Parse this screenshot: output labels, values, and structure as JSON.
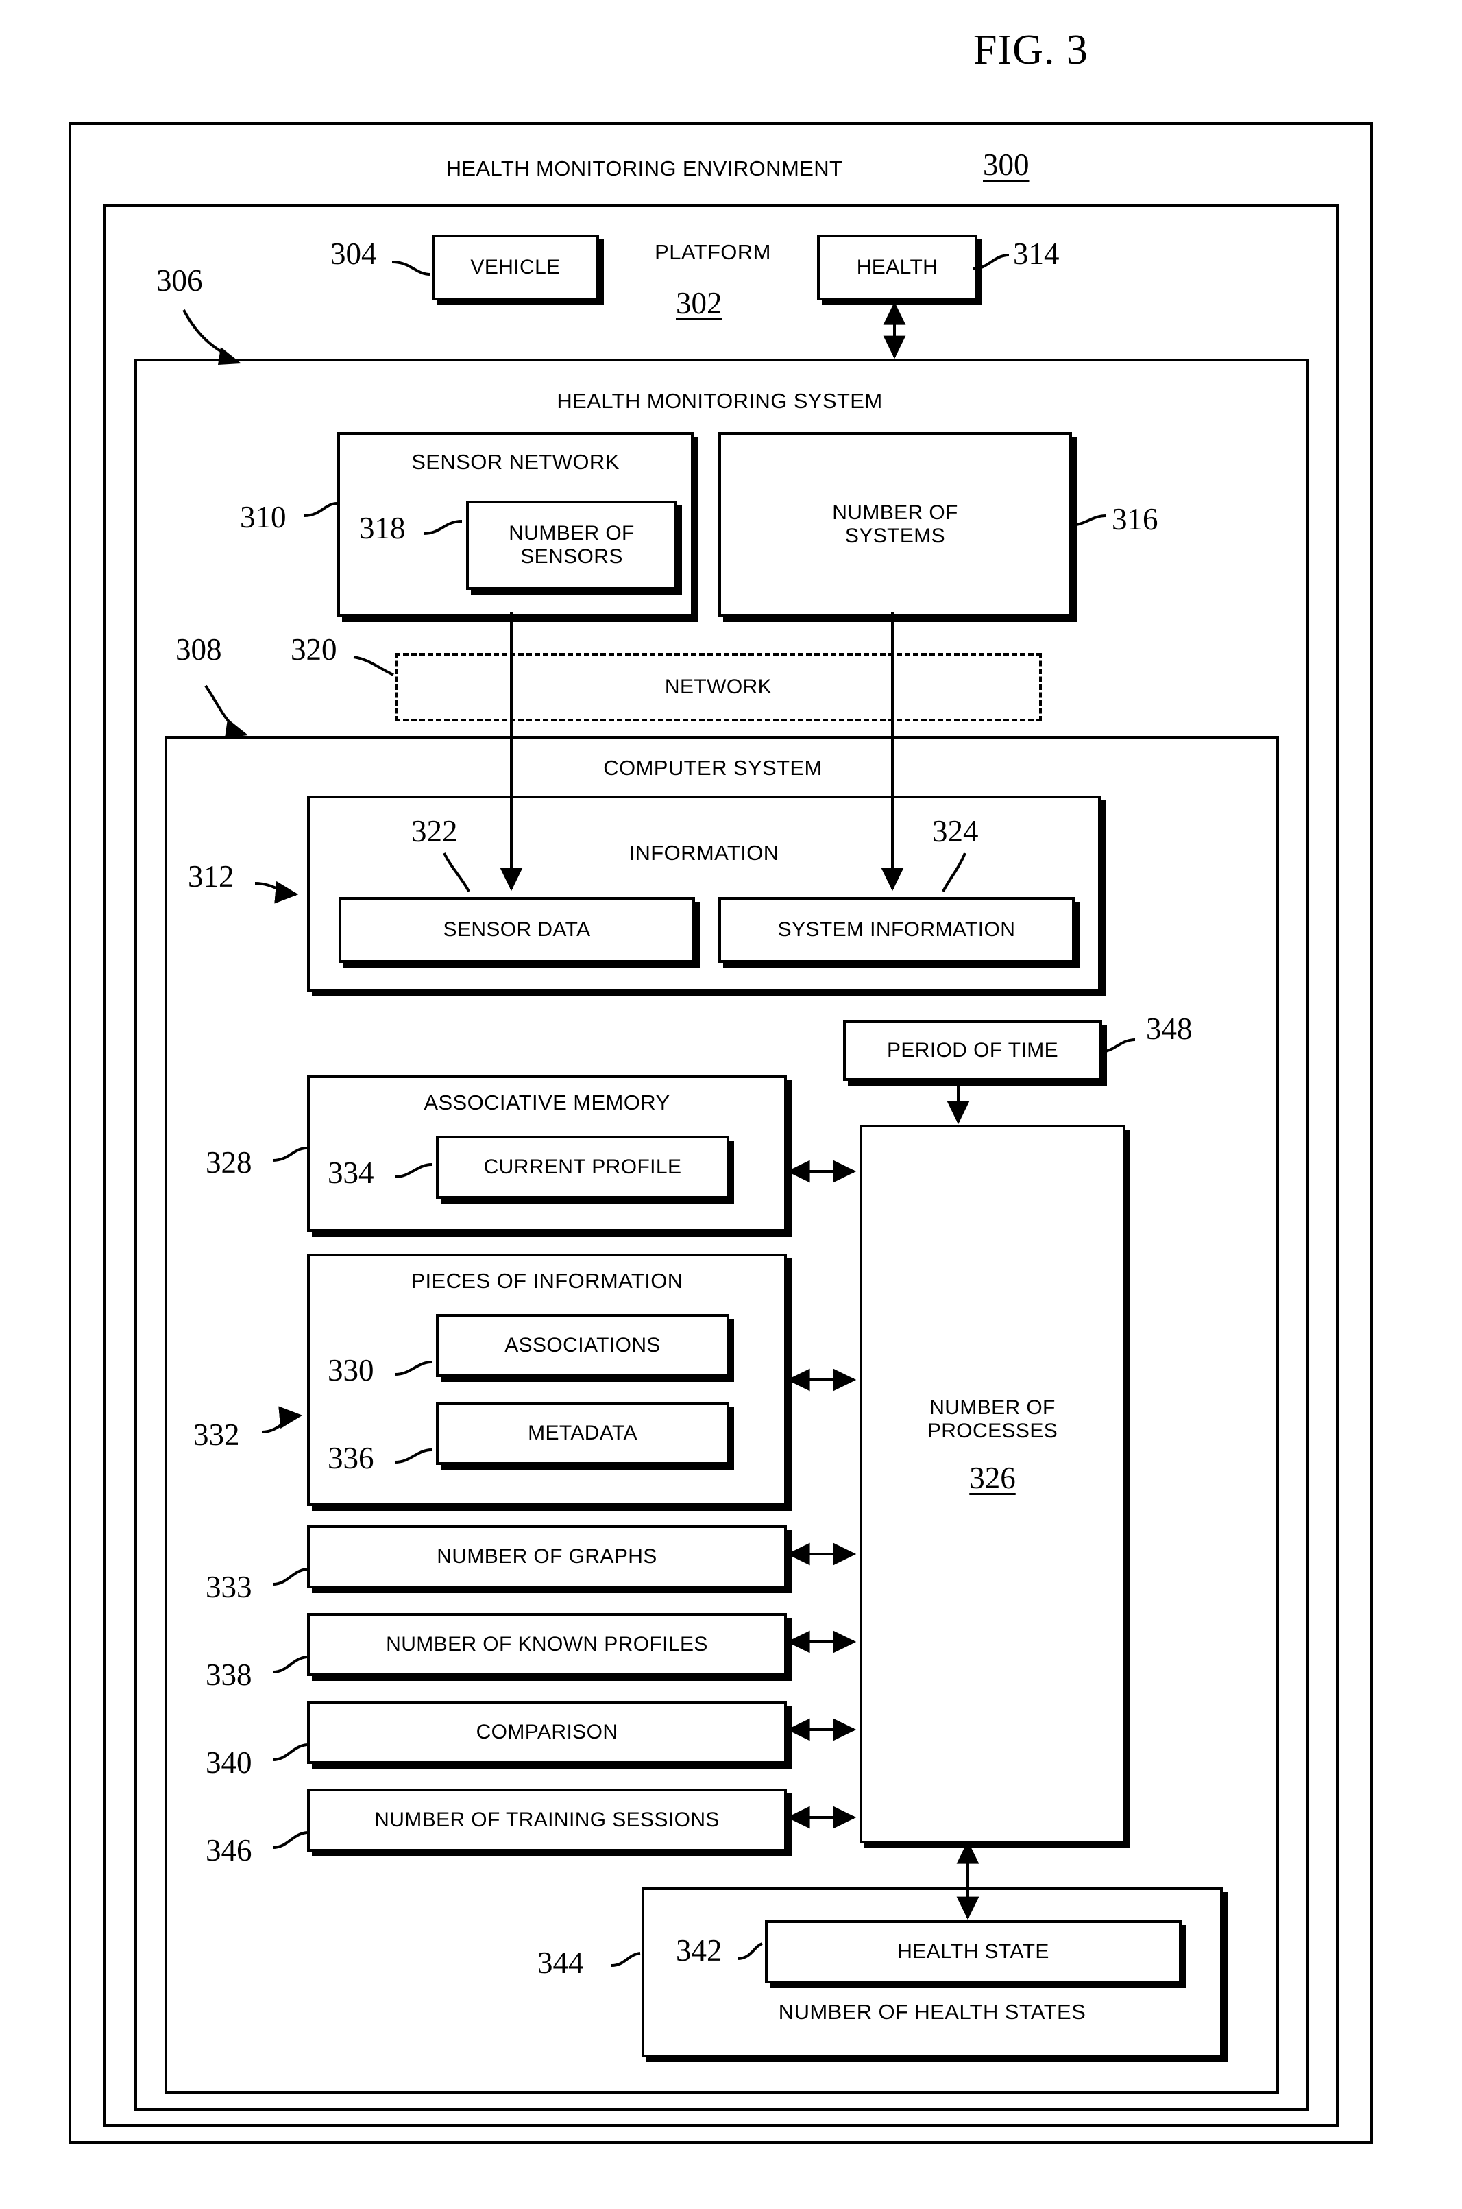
{
  "figure": {
    "title": "FIG. 3"
  },
  "environment": {
    "title": "HEALTH MONITORING ENVIRONMENT",
    "ref": "300"
  },
  "platform": {
    "title": "PLATFORM",
    "ref": "302",
    "vehicle": {
      "label": "VEHICLE",
      "ref": "304"
    },
    "health": {
      "label": "HEALTH",
      "ref": "314"
    },
    "system_ref": "306"
  },
  "health_monitoring_system": {
    "title": "HEALTH MONITORING SYSTEM",
    "sensor_network": {
      "title": "SENSOR NETWORK",
      "ref": "310",
      "number_of_sensors": {
        "label": "NUMBER OF SENSORS",
        "ref": "318"
      }
    },
    "number_of_systems": {
      "label": "NUMBER OF SYSTEMS",
      "ref": "316"
    },
    "network": {
      "label": "NETWORK",
      "ref": "320"
    },
    "computer_system_ref": "308"
  },
  "computer_system": {
    "title": "COMPUTER SYSTEM",
    "information": {
      "title": "INFORMATION",
      "ref": "312",
      "sensor_data": {
        "label": "SENSOR DATA",
        "ref": "322"
      },
      "system_information": {
        "label": "SYSTEM INFORMATION",
        "ref": "324"
      }
    },
    "period_of_time": {
      "label": "PERIOD OF TIME",
      "ref": "348"
    },
    "number_of_processes": {
      "line1": "NUMBER OF",
      "line2": "PROCESSES",
      "ref": "326"
    },
    "associative_memory": {
      "title": "ASSOCIATIVE MEMORY",
      "ref": "328",
      "current_profile": {
        "label": "CURRENT PROFILE",
        "ref": "334"
      }
    },
    "pieces_of_information": {
      "title": "PIECES OF INFORMATION",
      "ref": "332",
      "associations": {
        "label": "ASSOCIATIONS",
        "ref": "330"
      },
      "metadata": {
        "label": "METADATA",
        "ref": "336"
      }
    },
    "number_of_graphs": {
      "label": "NUMBER OF GRAPHS",
      "ref": "333"
    },
    "number_of_known_profiles": {
      "label": "NUMBER OF KNOWN PROFILES",
      "ref": "338"
    },
    "comparison": {
      "label": "COMPARISON",
      "ref": "340"
    },
    "number_of_training_sessions": {
      "label": "NUMBER OF TRAINING SESSIONS",
      "ref": "346"
    },
    "number_of_health_states": {
      "label": "NUMBER OF HEALTH STATES",
      "ref": "344",
      "health_state": {
        "label": "HEALTH STATE",
        "ref": "342"
      }
    }
  }
}
